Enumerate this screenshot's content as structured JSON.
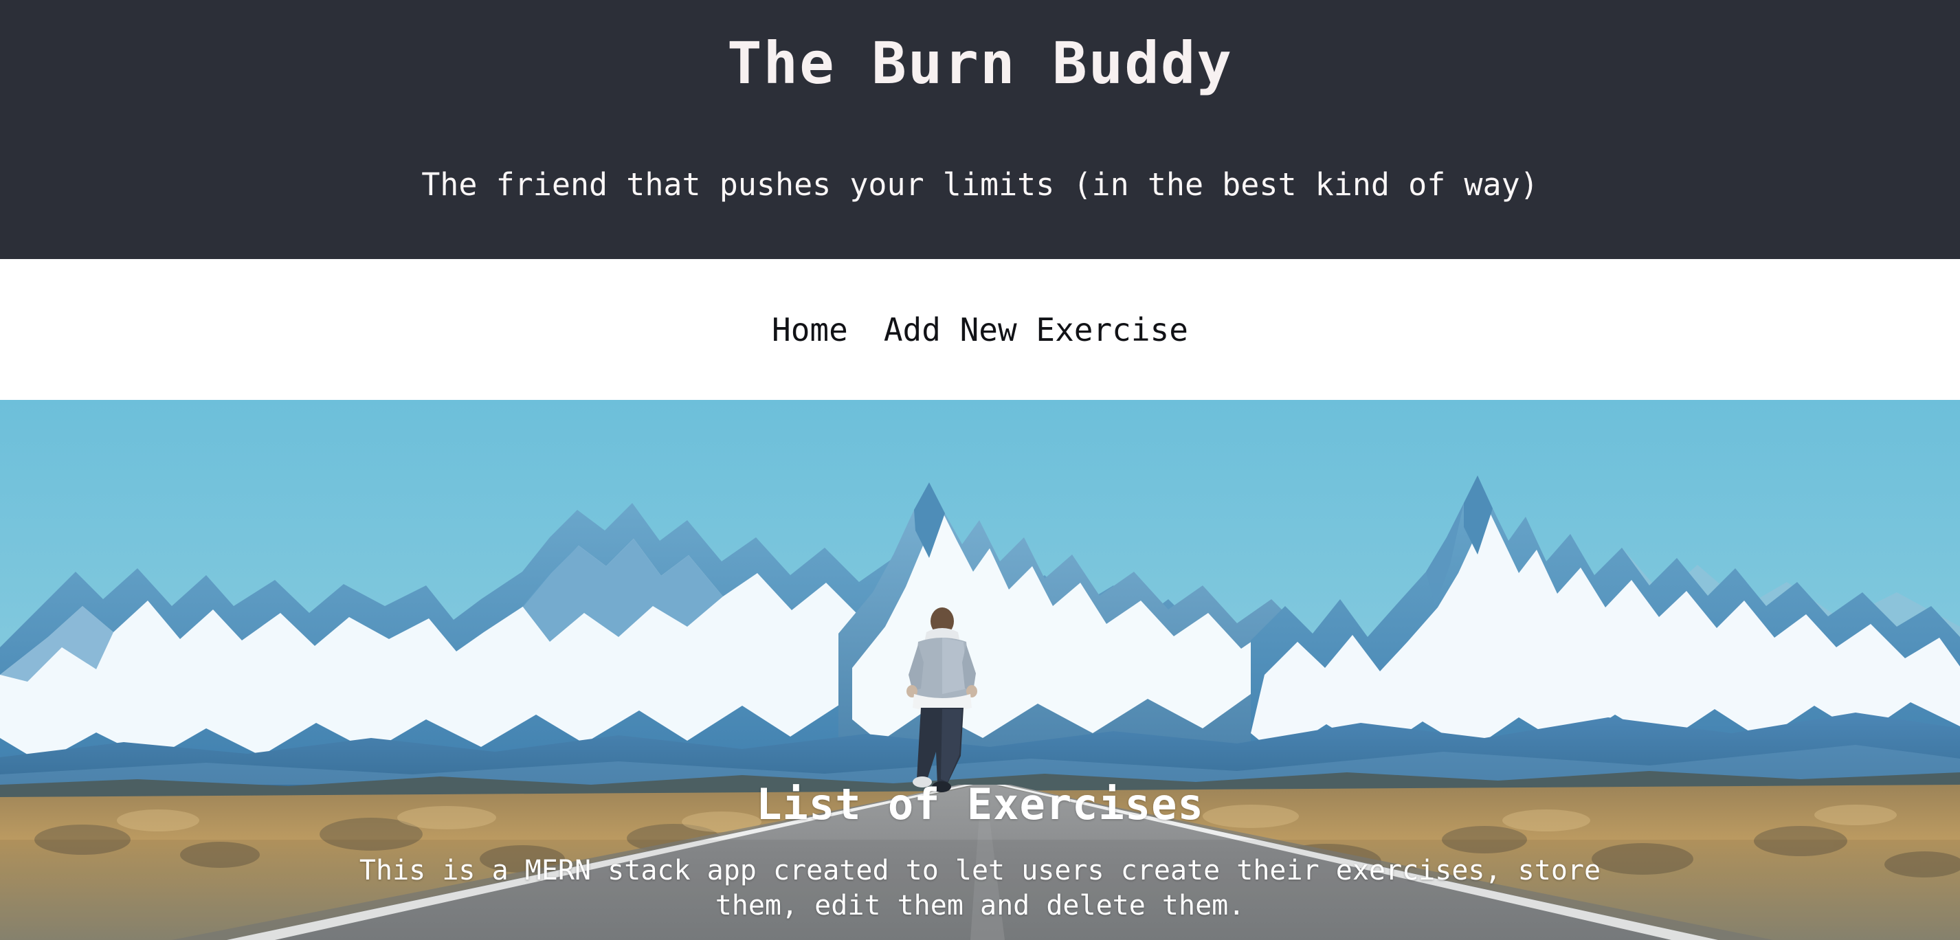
{
  "header": {
    "title": "The Burn Buddy",
    "tagline": "The friend that pushes your limits (in the best kind of way)",
    "background_color": "#2c2f38",
    "title_color": "#f7f1f1"
  },
  "nav": {
    "background_color": "#ffffff",
    "link_color": "#111216",
    "items": [
      {
        "label": "Home",
        "name": "nav-link-home"
      },
      {
        "label": "Add New Exercise",
        "name": "nav-link-add-new-exercise"
      }
    ]
  },
  "hero": {
    "heading": "List of Exercises",
    "description": "This is a MERN stack app created to let users create their exercises, store them, edit them and delete them.",
    "text_color": "#ffffff",
    "image_alt": "runner-on-mountain-road-photo",
    "colors": {
      "sky_top": "#6fc0da",
      "sky_bottom": "#a9d9e6",
      "mountain_snow": "#f4fafd",
      "mountain_rock": "#5d9cc4",
      "mountain_shadow": "#3b7ba8",
      "ridge_far": "#4a86b4",
      "scrub_gold": "#b49257",
      "road_asphalt": "#8e9092",
      "road_line": "#e9eaea",
      "runner_hoodie": "#aab6c2",
      "runner_jeans": "#2a3340"
    }
  }
}
